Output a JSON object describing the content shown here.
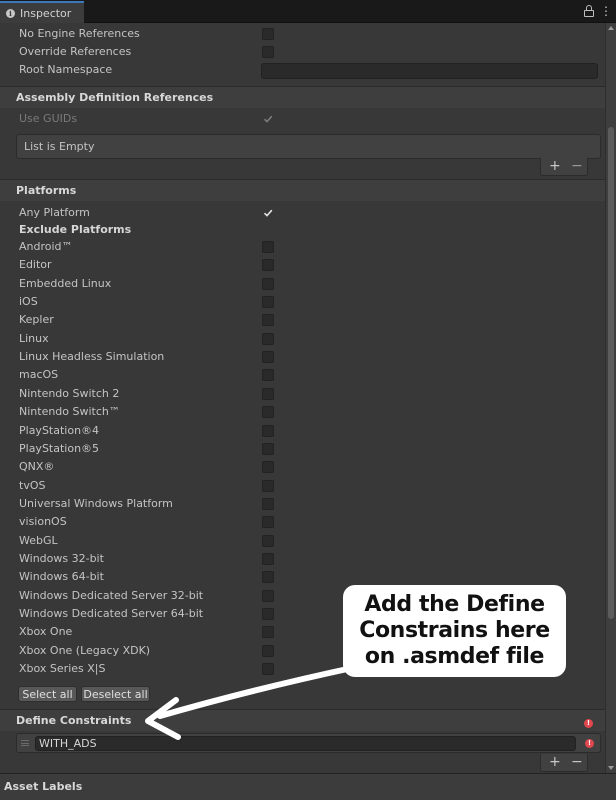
{
  "tab": {
    "icon": "info-icon",
    "title": "Inspector"
  },
  "top_rows": [
    {
      "label": "No Engine References",
      "control": "checkbox",
      "checked": false
    },
    {
      "label": "Override References",
      "control": "checkbox",
      "checked": false
    },
    {
      "label": "Root Namespace",
      "control": "text",
      "value": ""
    }
  ],
  "assembly_refs": {
    "title": "Assembly Definition References",
    "use_guids_label": "Use GUIDs",
    "use_guids_checked": true,
    "list_empty_text": "List is Empty",
    "add_symbol": "+",
    "remove_symbol": "−"
  },
  "platforms": {
    "title": "Platforms",
    "any_platform_label": "Any Platform",
    "any_platform_checked": true,
    "exclude_label": "Exclude Platforms",
    "items": [
      "Android™",
      "Editor",
      "Embedded Linux",
      "iOS",
      "Kepler",
      "Linux",
      "Linux Headless Simulation",
      "macOS",
      "Nintendo Switch 2",
      "Nintendo Switch™",
      "PlayStation®4",
      "PlayStation®5",
      "QNX®",
      "tvOS",
      "Universal Windows Platform",
      "visionOS",
      "WebGL",
      "Windows 32-bit",
      "Windows 64-bit",
      "Windows Dedicated Server 32-bit",
      "Windows Dedicated Server 64-bit",
      "Xbox One",
      "Xbox One (Legacy XDK)",
      "Xbox Series X|S"
    ],
    "select_all_label": "Select all",
    "deselect_all_label": "Deselect all"
  },
  "define_constraints": {
    "title": "Define Constraints",
    "items": [
      "WITH_ADS"
    ],
    "add_symbol": "+",
    "remove_symbol": "−",
    "error_symbol": "!"
  },
  "asset_labels": {
    "title": "Asset Labels"
  },
  "annotation": {
    "lines": [
      "Add the Define",
      "Constrains here",
      "on .asmdef file"
    ]
  },
  "colors": {
    "background": "#383838",
    "tab_accent": "#3a79bb",
    "error": "#e0474e",
    "callout_bg": "#ffffff"
  }
}
